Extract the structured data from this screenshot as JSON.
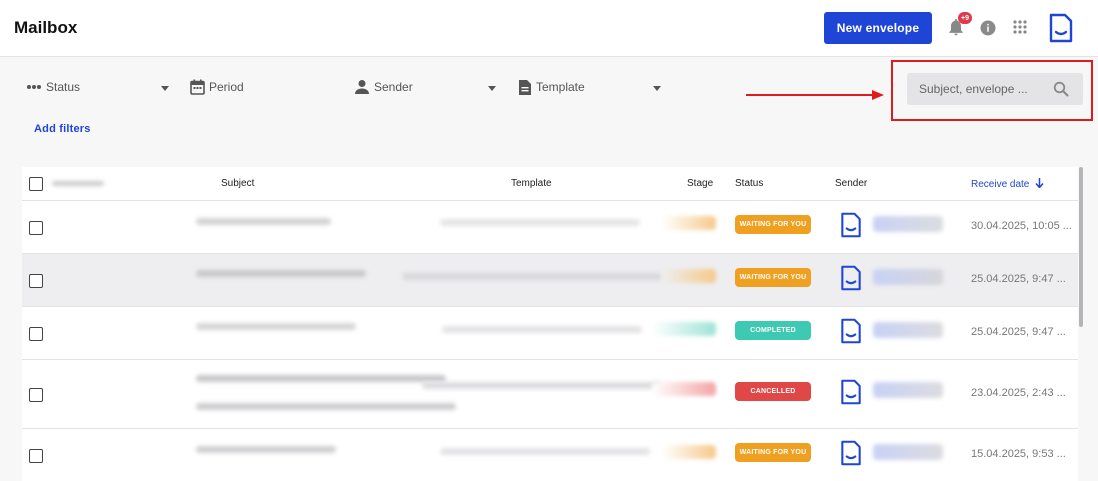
{
  "header": {
    "title": "Mailbox",
    "new_envelope": "New envelope",
    "notification_badge": "+9"
  },
  "filters": {
    "status": "Status",
    "period": "Period",
    "sender": "Sender",
    "template": "Template",
    "add_filters": "Add filters"
  },
  "search": {
    "placeholder": "Subject, envelope ..."
  },
  "table": {
    "columns": {
      "subject": "Subject",
      "template": "Template",
      "stage": "Stage",
      "status": "Status",
      "sender": "Sender",
      "receive_date": "Receive date"
    },
    "rows": [
      {
        "status": "WAITING FOR YOU",
        "status_color": "#f0a020",
        "date": "30.04.2025, 10:05 ..."
      },
      {
        "status": "WAITING FOR YOU",
        "status_color": "#f0a020",
        "date": "25.04.2025, 9:47 ..."
      },
      {
        "status": "COMPLETED",
        "status_color": "#3ec9b2",
        "date": "25.04.2025, 9:47 ..."
      },
      {
        "status": "CANCELLED",
        "status_color": "#e04848",
        "date": "23.04.2025, 2:43 ..."
      },
      {
        "status": "WAITING FOR YOU",
        "status_color": "#f0a020",
        "date": "15.04.2025, 9:53 ..."
      }
    ]
  },
  "colors": {
    "accent": "#1f45d6",
    "highlight_frame": "#e01b1b"
  },
  "icons": [
    "bell-icon",
    "info-icon",
    "apps-grid-icon",
    "document-logo-icon",
    "search-icon",
    "calendar-icon",
    "person-icon",
    "file-icon",
    "dots-icon",
    "sort-down-icon"
  ]
}
